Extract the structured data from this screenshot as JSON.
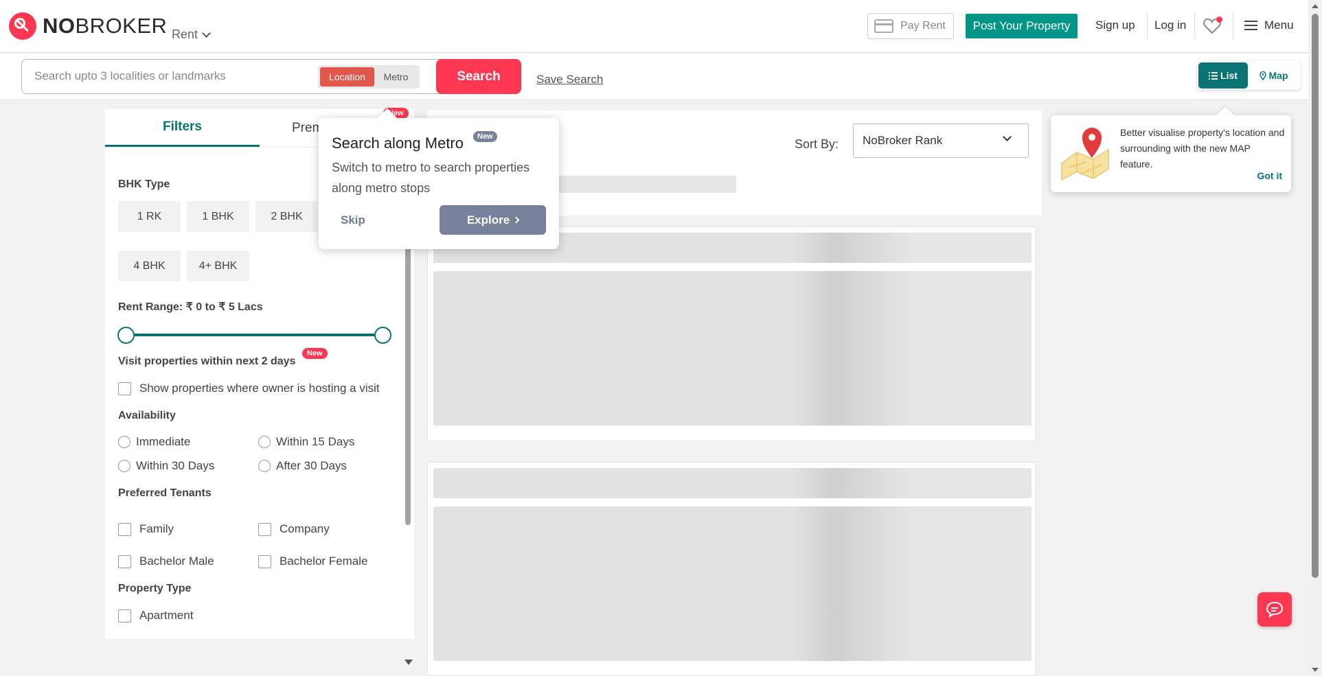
{
  "header": {
    "logo_no": "NO",
    "logo_broker": "BROKER",
    "mode_dropdown": "Rent",
    "pay_rent": "Pay Rent",
    "post_property": "Post Your Property",
    "sign_up": "Sign up",
    "log_in": "Log in",
    "menu": "Menu"
  },
  "search": {
    "placeholder": "Search upto 3 localities or landmarks",
    "toggle_location": "Location",
    "toggle_metro": "Metro",
    "search_button": "Search",
    "save_search": "Save Search",
    "view_list": "List",
    "view_map": "Map"
  },
  "filters": {
    "tab_filters": "Filters",
    "tab_premium": "Prem",
    "tab_new_badge": "New",
    "bhk_title": "BHK Type",
    "bhk_options": [
      "1 RK",
      "1 BHK",
      "2 BHK",
      "4 BHK",
      "4+ BHK"
    ],
    "rent_range": "Rent Range: ₹ 0 to ₹ 5 Lacs",
    "rent_range_min_fraction": 0,
    "rent_range_max_fraction": 1,
    "visit_title": "Visit properties within next 2 days",
    "visit_new_badge": "New",
    "visit_option": "Show properties where owner is hosting a visit",
    "availability_title": "Availability",
    "availability_options": [
      "Immediate",
      "Within 15 Days",
      "Within 30 Days",
      "After 30 Days"
    ],
    "tenants_title": "Preferred Tenants",
    "tenant_options": [
      "Family",
      "Company",
      "Bachelor Male",
      "Bachelor Female"
    ],
    "property_type_title": "Property Type",
    "property_type_options": [
      "Apartment"
    ]
  },
  "results": {
    "sort_label": "Sort By:",
    "sort_value": "NoBroker Rank"
  },
  "metro_popover": {
    "title": "Search along Metro",
    "new_badge": "New",
    "body": "Switch to metro to search properties along metro stops",
    "skip": "Skip",
    "explore": "Explore"
  },
  "map_tooltip": {
    "text": "Better visualise property's location and surrounding with the new MAP feature.",
    "got_it": "Got it"
  },
  "colors": {
    "brand_red": "#fd3752",
    "teal": "#009587",
    "dark_teal": "#0a7474",
    "slate": "#77819a"
  },
  "icons": [
    "card-icon",
    "heart-icon",
    "hamburger-icon",
    "chevron-down-icon",
    "list-icon",
    "map-pin-icon",
    "chat-icon",
    "map-illustration-icon",
    "arrow-right-icon"
  ]
}
